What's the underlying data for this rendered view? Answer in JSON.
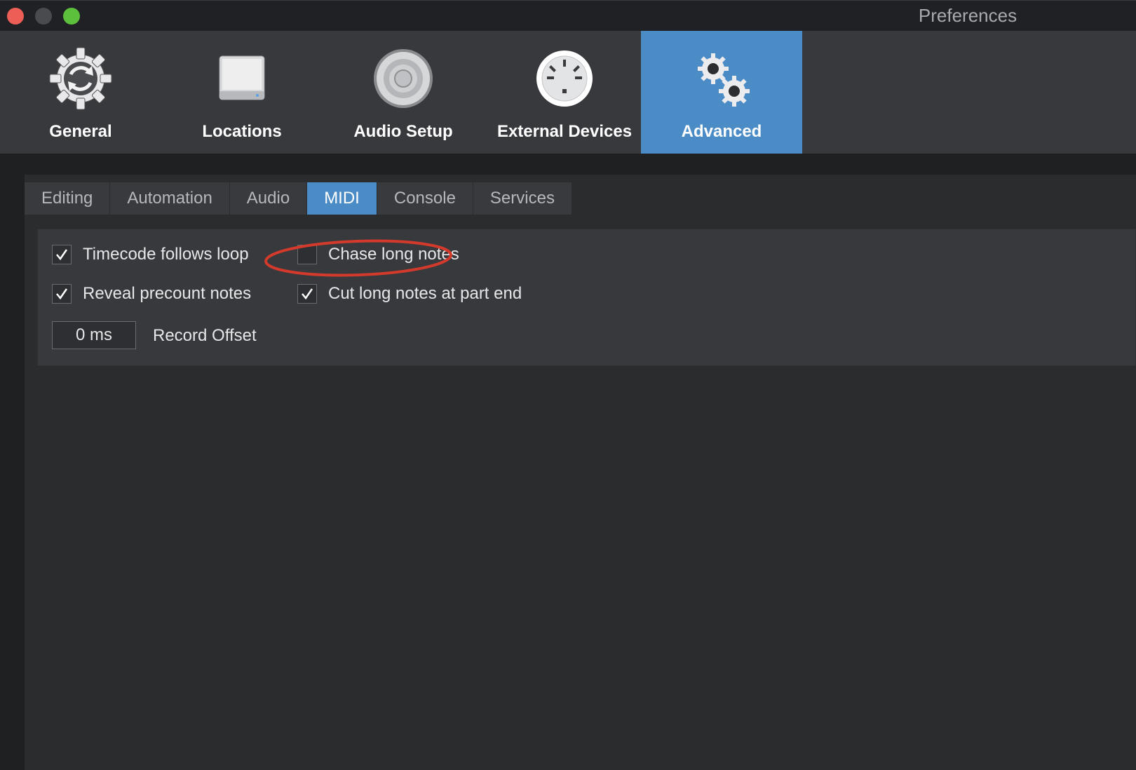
{
  "window": {
    "title": "Preferences"
  },
  "toolbar": {
    "items": [
      {
        "label": "General",
        "icon": "general-gear-icon"
      },
      {
        "label": "Locations",
        "icon": "drive-icon"
      },
      {
        "label": "Audio Setup",
        "icon": "speaker-icon"
      },
      {
        "label": "External Devices",
        "icon": "midi-port-icon"
      },
      {
        "label": "Advanced",
        "icon": "gears-icon",
        "selected": true
      }
    ]
  },
  "tabs": [
    {
      "label": "Editing"
    },
    {
      "label": "Automation"
    },
    {
      "label": "Audio"
    },
    {
      "label": "MIDI",
      "selected": true
    },
    {
      "label": "Console"
    },
    {
      "label": "Services"
    }
  ],
  "midi": {
    "options": [
      {
        "label": "Timecode follows loop",
        "checked": true
      },
      {
        "label": "Chase long notes",
        "checked": false
      },
      {
        "label": "Reveal precount notes",
        "checked": true
      },
      {
        "label": "Cut long notes at part end",
        "checked": true
      }
    ],
    "record_offset": {
      "value": "0 ms",
      "label": "Record Offset"
    }
  },
  "colors": {
    "accent": "#4b8bc6",
    "annotation": "#d33a2c",
    "close": "#ed5f56",
    "maximize": "#5dc03d"
  }
}
